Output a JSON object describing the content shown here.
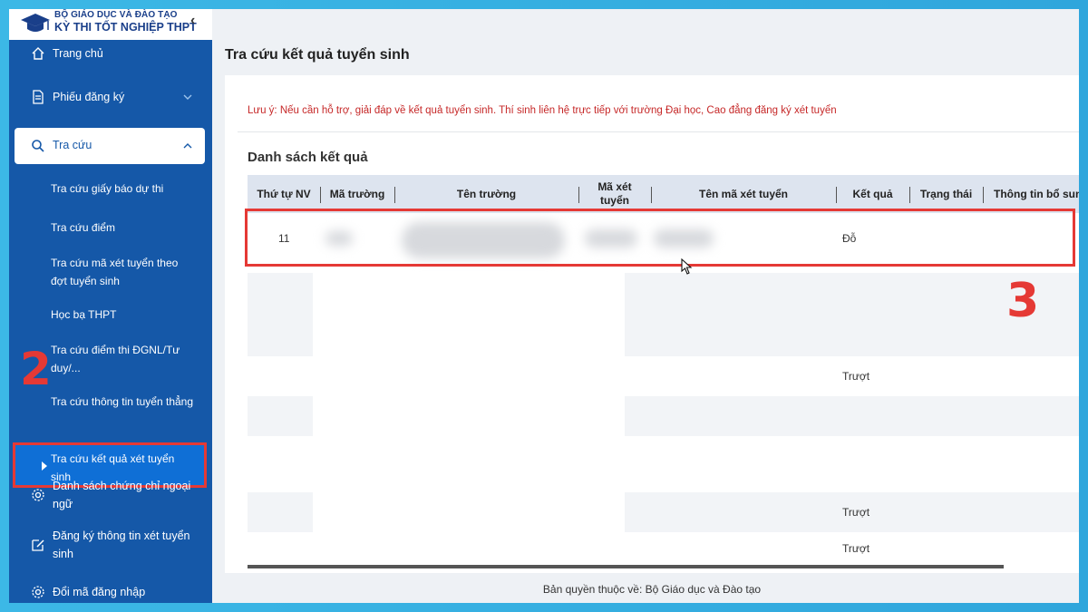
{
  "brand": {
    "org": "BỘ GIÁO DỤC VÀ ĐÀO TẠO",
    "app_name": "KỲ THI TỐT NGHIỆP THPT",
    "collapse_icon": "chevron-left-icon"
  },
  "sidebar": {
    "home": "Trang chủ",
    "registration": "Phiếu đăng ký",
    "lookup": "Tra cứu",
    "lookup_items": [
      "Tra cứu giấy báo dự thi",
      "Tra cứu điểm",
      "Tra cứu mã xét tuyển theo đợt tuyển sinh",
      "Học bạ THPT",
      "Tra cứu điểm thi ĐGNL/Tư duy/...",
      "Tra cứu thông tin tuyển thẳng",
      "Tra cứu kết quả xét tuyển sinh"
    ],
    "certificates": "Danh sách chứng chỉ ngoại ngữ",
    "register_info": "Đăng ký thông tin xét tuyển sinh",
    "change_login": "Đổi mã đăng nhập"
  },
  "annotations": {
    "step2": "2",
    "step3": "3"
  },
  "main": {
    "page_title": "Tra cứu kết quả tuyển sinh",
    "notice": "Lưu ý: Nếu cần hỗ trợ, giải đáp về kết quả tuyển sinh. Thí sinh liên hệ trực tiếp với trường Đại học, Cao đẳng đăng ký xét tuyển",
    "list_title": "Danh sách kết quả",
    "columns": [
      "Thứ tự NV",
      "Mã trường",
      "Tên trường",
      "Mã xét tuyển",
      "Tên mã xét tuyển",
      "Kết quả",
      "Trạng thái",
      "Thông tin bổ sung"
    ],
    "rows": [
      {
        "order": "11",
        "result": "Đỗ"
      },
      {
        "order": "",
        "result": ""
      },
      {
        "order": "",
        "result": ""
      },
      {
        "order": "",
        "result": "Trượt"
      },
      {
        "order": "",
        "result": ""
      },
      {
        "order": "",
        "result": ""
      },
      {
        "order": "",
        "result": "Trượt"
      },
      {
        "order": "",
        "result": "Trượt"
      }
    ]
  },
  "footer": "Bản quyền thuộc về: Bộ Giáo dục và Đào tạo",
  "colors": {
    "sidebar": "#1558a8",
    "active": "#0f6fd6",
    "highlight": "#e53935",
    "notice": "#c62828"
  }
}
